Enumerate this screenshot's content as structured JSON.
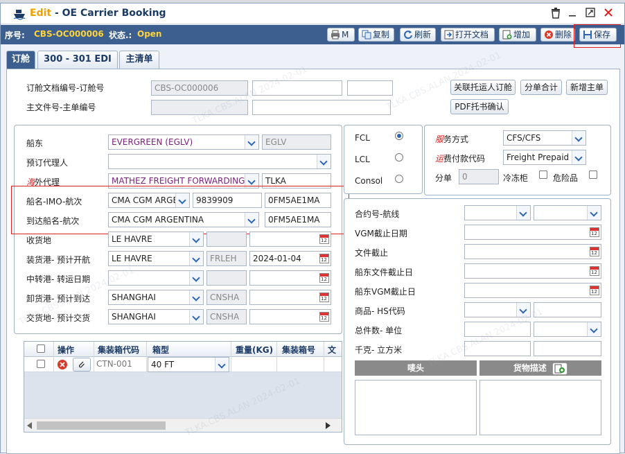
{
  "window": {
    "title_edit": "Edit",
    "title_rest": " - OE Carrier Booking",
    "colors": {
      "header": "#3c5f8f",
      "accent": "#ffd43b",
      "edit": "#f0a000"
    }
  },
  "infobar": {
    "seq_label": "序号:",
    "seq_value": "CBS-OC000006",
    "status_label": "状态.:",
    "status_value": "Open"
  },
  "toolbar": {
    "print": "M",
    "copy": "复制",
    "refresh": "刷新",
    "open_doc": "打开文档",
    "add": "增加",
    "delete": "删除",
    "save": "保存"
  },
  "tabs": [
    {
      "label": "订舱"
    },
    {
      "label": "300 - 301 EDI"
    },
    {
      "label": "主清单"
    }
  ],
  "top": {
    "booking_no_label": "订舱文档编号-订舱号",
    "booking_no": "CBS-OC000006",
    "master_label": "主文件号-主单编号",
    "btn_link": "关联托运人订舱",
    "btn_sum": "分单合计",
    "btn_new_master": "新增主单",
    "btn_pdf": "PDF托书确认"
  },
  "left": {
    "carrier_label": "船东",
    "carrier": "EVERGREEN (EGLV)",
    "carrier_code": "EGLV",
    "booking_agent_label": "预订代理人",
    "overseas_agent_red": "海",
    "overseas_agent_label": "外代理",
    "overseas_agent": "MATHEZ FREIGHT FORWARDING",
    "overseas_agent_code": "TLKA",
    "vessel_label": "船名-IMO-航次",
    "vessel": "CMA CGM ARGE",
    "imo": "9839909",
    "voyage1": "0FM5AE1MA",
    "arrival_vessel_label": "到达船名-航次",
    "arrival_vessel": "CMA CGM ARGENTINA",
    "voyage2": "0FM5AE1MA",
    "receipt_label": "收货地",
    "receipt": "LE HAVRE",
    "pol_label": "装货港- 预计开航",
    "pol": "LE HAVRE",
    "pol_code": "FRLEH",
    "etd": "2024-01-04",
    "transit_label": "中转港- 转运日期",
    "pod_label": "卸货港- 预计到达",
    "pod": "SHANGHAI",
    "pod_code": "CNSHA",
    "delivery_label": "交货地- 预计交货",
    "delivery": "SHANGHAI",
    "delivery_code": "CNSHA"
  },
  "mode": {
    "fcl": "FCL",
    "lcl": "LCL",
    "consol": "Consol"
  },
  "service": {
    "service_red": "服",
    "service_label": "务方式",
    "service": "CFS/CFS",
    "pay_red": "运",
    "pay_label": "费付款代码",
    "pay": "Freight Prepaid",
    "split_label": "分单",
    "split": "0",
    "reefer_label": "冷冻柜",
    "dg_label": "危险品"
  },
  "right": {
    "contract_label": "合约号-航线",
    "vgm_cutoff_label": "VGM截止日期",
    "doc_cutoff_label": "文件截止",
    "carrier_doc_cutoff_label": "船东文件截止日",
    "carrier_vgm_cutoff_label": "船东VGM截止日",
    "commodity_label": "商品-  HS代码",
    "packages_label": "总件数- 单位",
    "weight_label": "千克- 立方米",
    "marks_header": "唛头",
    "desc_header": "货物描述"
  },
  "grid": {
    "headers": {
      "action": "操作",
      "container_code": "集装箱代码",
      "type": "箱型",
      "weight": "重量(KG)",
      "container_no": "集装箱号",
      "more": "文"
    },
    "row": {
      "code": "CTN-001",
      "type": "40 FT"
    }
  },
  "watermark": "TLKA.CBS.ALAN 2024-02-01"
}
